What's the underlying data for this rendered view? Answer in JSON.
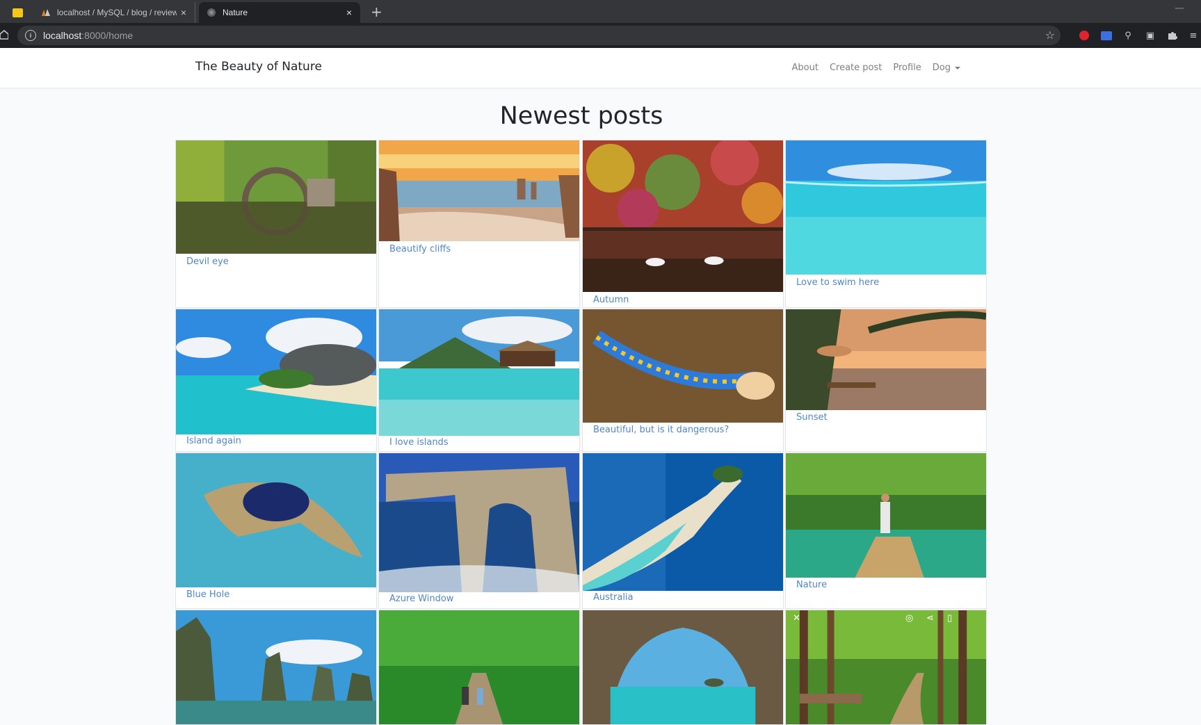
{
  "browser": {
    "tabs": [
      {
        "label": "localhost / MySQL / blog / review"
      },
      {
        "label": "Nature"
      }
    ],
    "url_host": "localhost",
    "url_rest": ":8000/home",
    "new_tab_glyph": "+",
    "close_glyph": "×"
  },
  "navbar": {
    "brand": "The Beauty of Nature",
    "links": [
      "About",
      "Create post",
      "Profile",
      "Dog"
    ]
  },
  "page": {
    "heading": "Newest posts"
  },
  "posts": [
    {
      "caption": "Devil eye",
      "image": "stone-arch-bridge-reflection"
    },
    {
      "caption": "Beautify cliffs",
      "image": "sunset-beach-cliffs"
    },
    {
      "caption": "Autumn",
      "image": "autumn-forest-swans"
    },
    {
      "caption": "Love to swim here",
      "image": "turquoise-water"
    },
    {
      "caption": "Island again",
      "image": "tropical-rocks-beach"
    },
    {
      "caption": "I love islands",
      "image": "overwater-bungalow"
    },
    {
      "caption": "Beautiful, but is it dangerous?",
      "image": "sea-slug"
    },
    {
      "caption": "Sunset",
      "image": "palm-beach-sunset"
    },
    {
      "caption": "Blue Hole",
      "image": "blue-hole-reef"
    },
    {
      "caption": "Azure Window",
      "image": "rock-arch-sea"
    },
    {
      "caption": "Australia",
      "image": "sandbar-island-aerial"
    },
    {
      "caption": "Nature",
      "image": "bamboo-raft-river"
    },
    {
      "caption": "",
      "image": "karst-bay-boats"
    },
    {
      "caption": "",
      "image": "forest-path-hikers"
    },
    {
      "caption": "",
      "image": "sea-cave-view"
    },
    {
      "caption": "",
      "image": "forest-road-benches"
    }
  ],
  "colors": {
    "link": "#4f86c6",
    "page_bg": "#f8fafc"
  }
}
